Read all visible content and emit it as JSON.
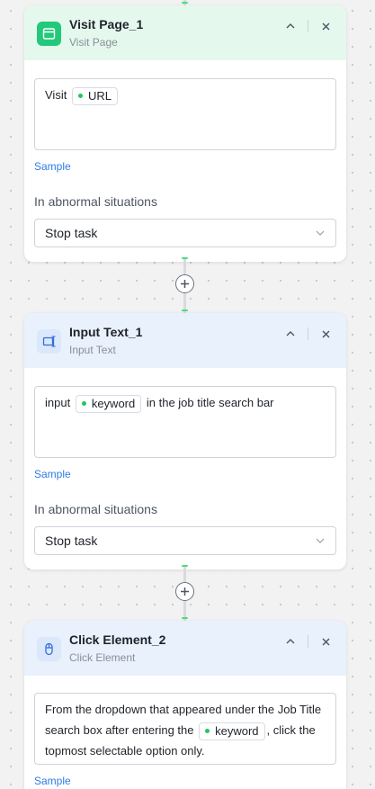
{
  "nodes": [
    {
      "title": "Visit Page_1",
      "subtitle": "Visit Page",
      "desc_prefix": "Visit",
      "chip": "URL",
      "sample": "Sample",
      "abnormal_label": "In abnormal situations",
      "abnormal_value": "Stop task",
      "header_color": "#e5f8ee",
      "icon": "browser-window-icon"
    },
    {
      "title": "Input Text_1",
      "subtitle": "Input Text",
      "desc_prefix": "input",
      "chip": "keyword",
      "desc_suffix": "in the job title search bar",
      "sample": "Sample",
      "abnormal_label": "In abnormal situations",
      "abnormal_value": "Stop task",
      "header_color": "#e9f1fc",
      "icon": "keyboard-input-icon"
    },
    {
      "title": "Click Element_2",
      "subtitle": "Click Element",
      "desc_prefix": "From the dropdown that appeared under the Job Title search box after entering the",
      "chip": "keyword",
      "desc_suffix": ", click the topmost selectable option only.",
      "sample": "Sample",
      "header_color": "#e9f1fc",
      "icon": "mouse-icon"
    }
  ],
  "colors": {
    "accent_link": "#2f7de1",
    "chip_dot": "#22c55e",
    "connector_tick": "#4ade80"
  }
}
